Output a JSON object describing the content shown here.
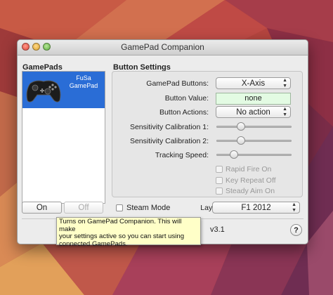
{
  "window": {
    "title": "GamePad Companion"
  },
  "gamepads": {
    "label": "GamePads",
    "items": [
      {
        "name_line1": "FuSa",
        "name_line2": "GamePad",
        "icon": "gamepad-icon"
      }
    ]
  },
  "button_settings": {
    "label": "Button Settings",
    "gamepad_buttons": {
      "label": "GamePad Buttons:",
      "value": "X-Axis"
    },
    "button_value": {
      "label": "Button Value:",
      "value": "none"
    },
    "button_actions": {
      "label": "Button Actions:",
      "value": "No action"
    },
    "sensitivity_1": {
      "label": "Sensitivity Calibration  1:",
      "level": 0.3
    },
    "sensitivity_2": {
      "label": "Sensitivity Calibration 2:",
      "level": 0.3
    },
    "tracking_speed": {
      "label": "Tracking Speed:",
      "level": 0.2
    },
    "rapid_fire": {
      "label": "Rapid Fire On",
      "checked": false,
      "enabled": false
    },
    "key_repeat": {
      "label": "Key Repeat Off",
      "checked": false,
      "enabled": false
    },
    "steady_aim": {
      "label": "Steady Aim On",
      "checked": false,
      "enabled": false
    }
  },
  "controls": {
    "on_label": "On",
    "off_label": "Off",
    "steam_mode_label": "Steam Mode",
    "layouts_label": "Layouts:",
    "layouts_value": "F1 2012"
  },
  "footer": {
    "version": "v3.1",
    "help_label": "?"
  },
  "tooltip": {
    "line1": "Turns on GamePad Companion. This will make",
    "line2": "your settings active so you can start using",
    "line3": "connected GamePads."
  },
  "colors": {
    "selection": "#2a6dd6",
    "value_field": "#e3fbe3",
    "tooltip_bg": "#ffffc8"
  }
}
